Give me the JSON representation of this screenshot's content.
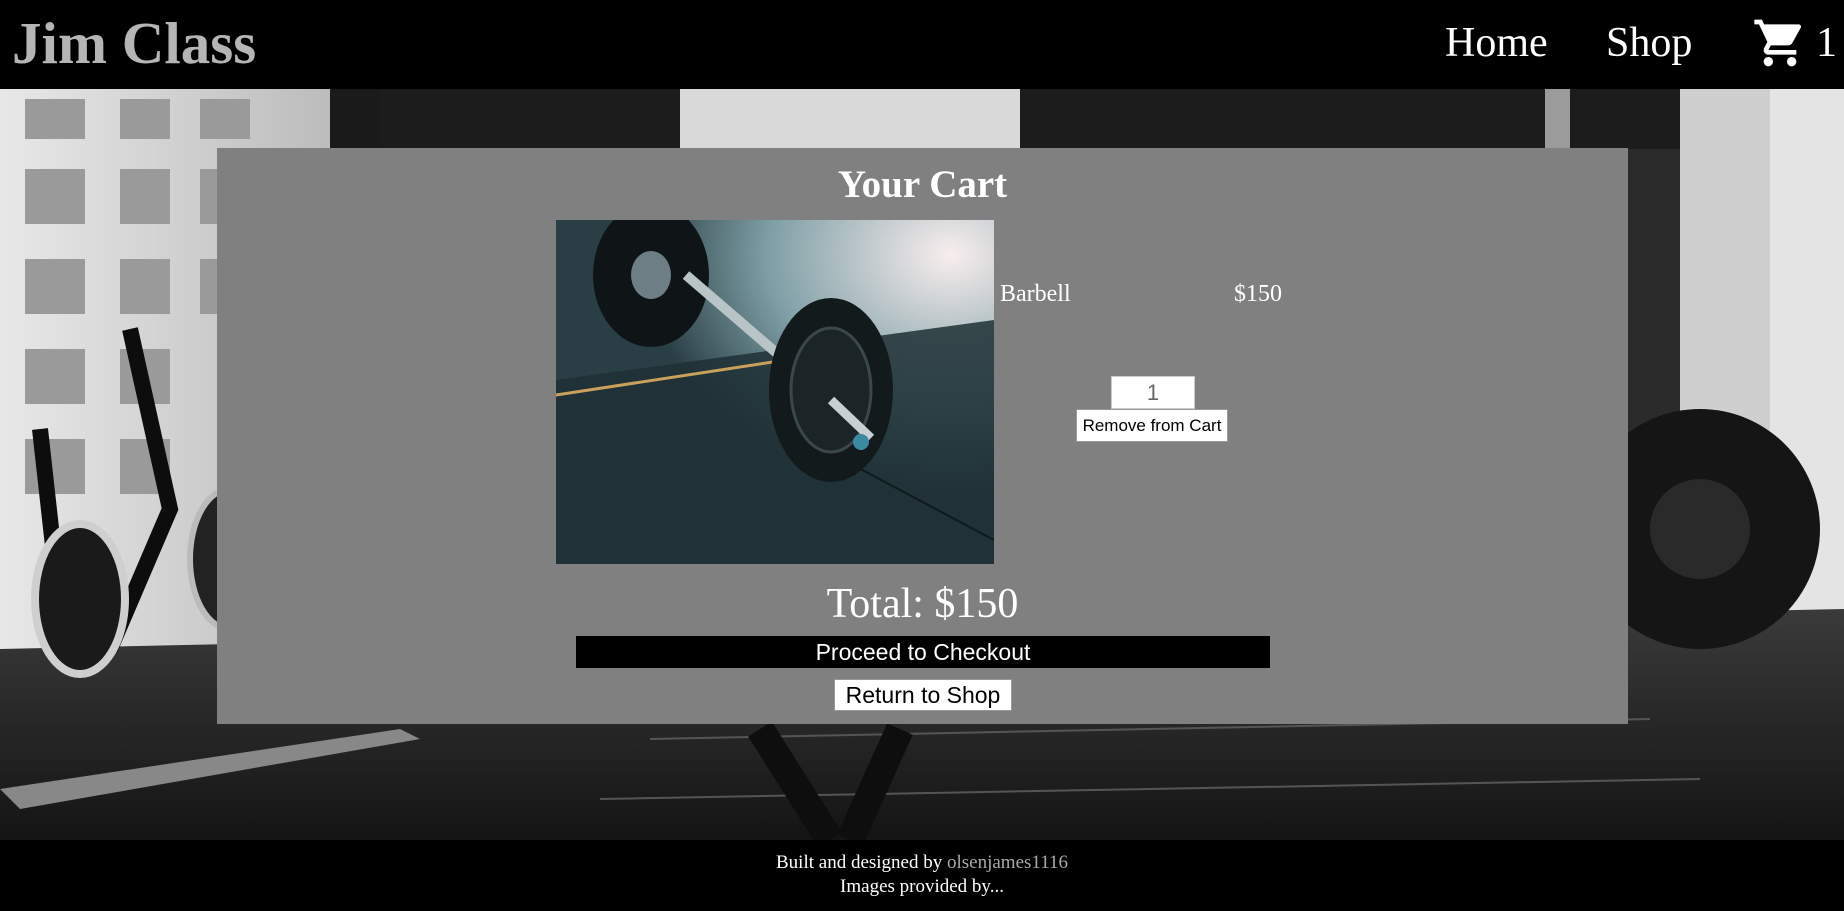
{
  "header": {
    "brand": "Jim Class",
    "nav": {
      "home": "Home",
      "shop": "Shop"
    },
    "cart_icon": "shopping-cart-icon",
    "cart_count": "1"
  },
  "cart": {
    "title": "Your Cart",
    "items": [
      {
        "name": "Barbell",
        "price": "$150",
        "quantity": "1",
        "remove_label": "Remove from Cart"
      }
    ],
    "total": "Total: $150",
    "checkout_label": "Proceed to Checkout",
    "return_label": "Return to Shop"
  },
  "footer": {
    "built_prefix": "Built and designed by",
    "author": "olsenjames1116",
    "images_credit": "Images provided by..."
  },
  "colors": {
    "panel": "#808080",
    "brand": "#b5b5b5",
    "footer_link": "#a9a9a9"
  }
}
